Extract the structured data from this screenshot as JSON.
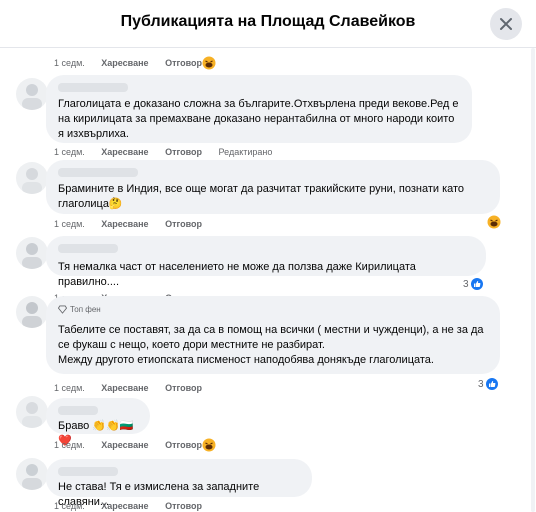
{
  "header": {
    "title": "Публикацията на Площад Славейков"
  },
  "labels": {
    "like": "Харесване",
    "reply": "Отговор",
    "edited": "Редактирано"
  },
  "comments": [
    {
      "time": "1 седм."
    },
    {
      "time": "1 седм.",
      "text": "Глаголицата е доказано сложна за българите.Отхвърлена преди векове.Ред е на кирилицата за премахване доказано нерантабилна от много народи които я изхвърлиха."
    },
    {
      "time": "1 седм.",
      "text": "Брамините в Индия, все още могат да разчитат тракийските руни, познати като глаголица🤔"
    },
    {
      "time": "1 седм.",
      "text": "Тя немалка част от населението не може да ползва даже Кирилицата правилно....",
      "reactions": "3"
    },
    {
      "time": "1 седм.",
      "badge": "Топ фен",
      "text": "Табелите се поставят, за да са в помощ на всички ( местни и чужденци), а не за да се фукаш с нещо, което дори местните не разбират.\nМежду другото етиопската писменост наподобява донякъде глаголицата.",
      "reactions": "3"
    },
    {
      "time": "1 седм.",
      "text": "Браво 👏👏🇧🇬❤️"
    },
    {
      "time": "1 седм.",
      "text": "Не става! Тя е измислена за западните славяни..."
    }
  ],
  "colors": {
    "accent": "#1877f2",
    "bubble": "#f0f2f5",
    "meta": "#65676b",
    "haha": "#f7b125"
  }
}
